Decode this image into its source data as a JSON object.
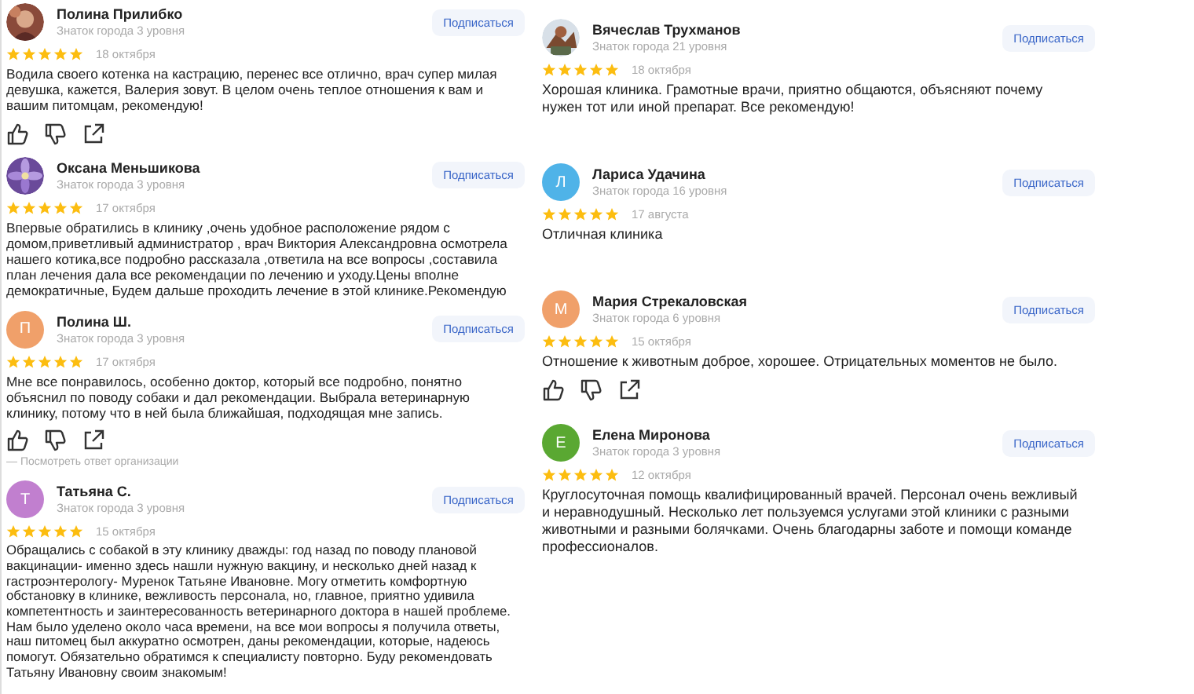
{
  "columns": [
    {
      "reviews": [
        {
          "name": "Полина Прилибко",
          "level": "Знаток города 3 уровня",
          "subscribe": "Подписаться",
          "stars": 5,
          "date": "18 октября",
          "text": "Водила своего котенка на кастрацию, перенес все отлично, врач супер милая девушка, кажется, Валерия зовут. В целом очень теплое отношения к вам и вашим питомцам, рекомендую!",
          "actions": true
        },
        {
          "name": "Оксана Меньшикова",
          "level": "Знаток города 3 уровня",
          "subscribe": "Подписаться",
          "stars": 5,
          "date": "17 октября",
          "text": "Впервые обратились в клинику ,очень удобное расположение рядом с домом,приветливый администратор , врач Виктория Александровна осмотрела нашего котика,все подробно рассказала ,ответила на все вопросы ,составила план лечения дала все рекомендации по лечению и уходу.Цены вполне демократичные, Будем дальше проходить лечение в этой клинике.Рекомендую",
          "actions": false
        },
        {
          "name": "Полина Ш.",
          "level": "Знаток города 3 уровня",
          "subscribe": "Подписаться",
          "avatar": {
            "kind": "letter",
            "letter": "П",
            "color": "#f0a06a"
          },
          "stars": 5,
          "date": "17 октября",
          "text": "Мне все понравилось, особенно доктор, который все подробно, понятно объяснил по поводу собаки и дал рекомендации. Выбрала ветеринарную клинику, потому что в ней была ближайшая, подходящая мне запись.",
          "actions": true,
          "reply_link": "— Посмотреть ответ организации"
        },
        {
          "name": "Татьяна С.",
          "level": "Знаток города 3 уровня",
          "subscribe": "Подписаться",
          "avatar": {
            "kind": "letter",
            "letter": "Т",
            "color": "#c17fcf"
          },
          "stars": 5,
          "date": "15 октября",
          "text": "Обращались с собакой в эту клинику дважды: год назад по поводу плановой вакцинации- именно здесь нашли нужную вакцину, и несколько дней назад к гастроэнтерологу- Муренок Татьяне Ивановне. Могу отметить комфортную обстановку в клинике, вежливость персонала, но, главное, приятно удивила компетентность и заинтересованность ветеринарного доктора в нашей проблеме. Нам было уделено около часа времени, на все мои вопросы я получила ответы, наш питомец был аккуратно осмотрен, даны рекомендации, которые, надеюсь помогут. Обязательно обратимся к специалисту повторно. Буду рекомендовать Татьяну Ивановну своим знакомым!",
          "actions": false
        }
      ]
    },
    {
      "reviews": [
        {
          "name": "Вячеслав Трухманов",
          "level": "Знаток города 21 уровня",
          "subscribe": "Подписаться",
          "stars": 5,
          "date": "18 октября",
          "text": "Хорошая клиника. Грамотные врачи, приятно общаются, объясняют почему нужен тот или иной препарат. Все рекомендую!",
          "actions": false
        },
        {
          "name": "Лариса Удачина",
          "level": "Знаток города 16 уровня",
          "subscribe": "Подписаться",
          "avatar": {
            "kind": "letter",
            "letter": "Л",
            "color": "#4fb3e8"
          },
          "stars": 5,
          "date": "17 августа",
          "text": "Отличная клиника",
          "actions": false
        },
        {
          "name": "Мария Стрекаловская",
          "level": "Знаток города 6 уровня",
          "subscribe": "Подписаться",
          "avatar": {
            "kind": "letter",
            "letter": "М",
            "color": "#f0a06a"
          },
          "stars": 5,
          "date": "15 октября",
          "text": "Отношение к животным доброе, хорошее. Отрицательных моментов не было.",
          "actions": true
        },
        {
          "name": "Елена Миронова",
          "level": "Знаток города 3 уровня",
          "subscribe": "Подписаться",
          "avatar": {
            "kind": "letter",
            "letter": "Е",
            "color": "#5aa832"
          },
          "stars": 5,
          "date": "12 октября",
          "text": "Круглосуточная помощь квалифицированный врачей. Персонал очень вежливый и неравнодушный. Несколько лет пользуемся услугами этой клиники с разными животными и разными болячками. Очень благодарны заботе и помощи команде профессионалов.",
          "actions": false
        }
      ]
    }
  ]
}
